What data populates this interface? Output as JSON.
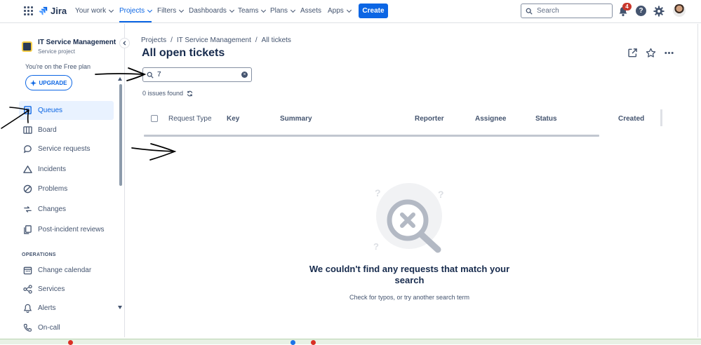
{
  "app": {
    "name": "Jira",
    "colors": {
      "accent": "#0c66e4",
      "text": "#172b4d",
      "subtle": "#44546f",
      "badge": "#c9372c",
      "selected_bg": "#e9f2ff"
    }
  },
  "topnav": {
    "items": [
      {
        "label": "Your work",
        "dropdown": true
      },
      {
        "label": "Projects",
        "dropdown": true,
        "active": true
      },
      {
        "label": "Filters",
        "dropdown": true
      },
      {
        "label": "Dashboards",
        "dropdown": true
      },
      {
        "label": "Teams",
        "dropdown": true
      },
      {
        "label": "Plans",
        "dropdown": true
      },
      {
        "label": "Assets",
        "dropdown": false
      },
      {
        "label": "Apps",
        "dropdown": true
      }
    ],
    "create_label": "Create",
    "search_placeholder": "Search",
    "notification_count": "4",
    "help_label": "?"
  },
  "sidebar": {
    "project_name": "IT Service Management",
    "project_type": "Service project",
    "plan_text": "You're on the Free plan",
    "upgrade_label": "UPGRADE",
    "items": [
      {
        "label": "Queues",
        "icon": "queues-icon",
        "active": true
      },
      {
        "label": "Board",
        "icon": "board-icon"
      },
      {
        "label": "Service requests",
        "icon": "service-requests-icon"
      },
      {
        "label": "Incidents",
        "icon": "incidents-icon"
      },
      {
        "label": "Problems",
        "icon": "problems-icon"
      },
      {
        "label": "Changes",
        "icon": "changes-icon"
      },
      {
        "label": "Post-incident reviews",
        "icon": "post-incident-reviews-icon"
      }
    ],
    "operations_label": "OPERATIONS",
    "operations_items": [
      {
        "label": "Change calendar",
        "icon": "calendar-icon"
      },
      {
        "label": "Services",
        "icon": "services-icon"
      },
      {
        "label": "Alerts",
        "icon": "bell-icon"
      },
      {
        "label": "On-call",
        "icon": "phone-icon"
      }
    ]
  },
  "main": {
    "breadcrumb": [
      "Projects",
      "IT Service Management",
      "All tickets"
    ],
    "breadcrumb_sep": "/",
    "title": "All open tickets",
    "search_value": "7",
    "issues_found": "0 issues found",
    "columns": [
      "Request Type",
      "Key",
      "Summary",
      "Reporter",
      "Assignee",
      "Status",
      "Created"
    ],
    "empty_title": "We couldn't find any requests that match your search",
    "empty_subtitle": "Check for typos, or try another search term"
  }
}
